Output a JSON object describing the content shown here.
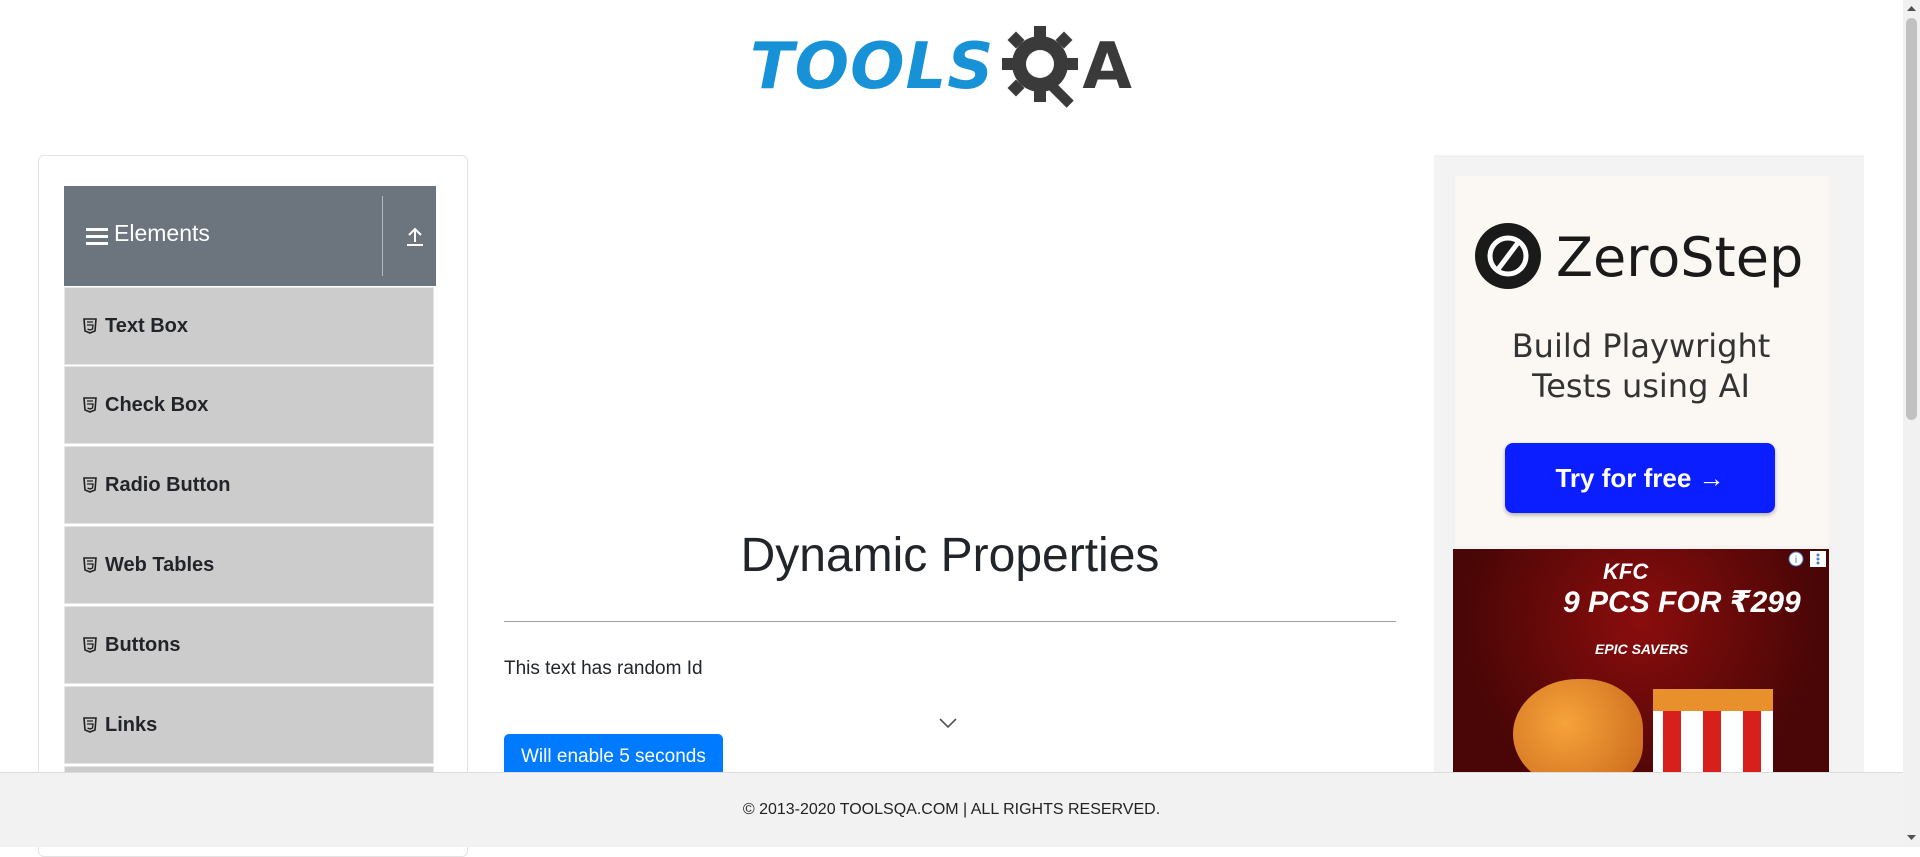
{
  "header": {
    "logo_text_primary": "TOOLS",
    "logo_text_secondary": "A"
  },
  "sidebar": {
    "group_title": "Elements",
    "items": [
      {
        "label": "Text Box"
      },
      {
        "label": "Check Box"
      },
      {
        "label": "Radio Button"
      },
      {
        "label": "Web Tables"
      },
      {
        "label": "Buttons"
      },
      {
        "label": "Links"
      }
    ]
  },
  "main": {
    "title": "Dynamic Properties",
    "random_text": "This text has random Id",
    "enable_button_label": "Will enable 5 seconds"
  },
  "ads": {
    "zerostep": {
      "brand": "ZeroStep",
      "tagline_line1": "Build Playwright",
      "tagline_line2": "Tests using AI",
      "cta": "Try for free →"
    },
    "kfc": {
      "brand": "KFC",
      "price": "9 PCS FOR ₹299",
      "subtitle": "EPIC SAVERS"
    }
  },
  "footer": {
    "text": "© 2013-2020 TOOLSQA.COM | ALL RIGHTS RESERVED."
  },
  "colors": {
    "brand_blue": "#1892d7",
    "group_header": "#6c757d",
    "menu_item_bg": "#cccccc",
    "primary_button": "#007bff",
    "zerostep_cta": "#0a1eff"
  }
}
